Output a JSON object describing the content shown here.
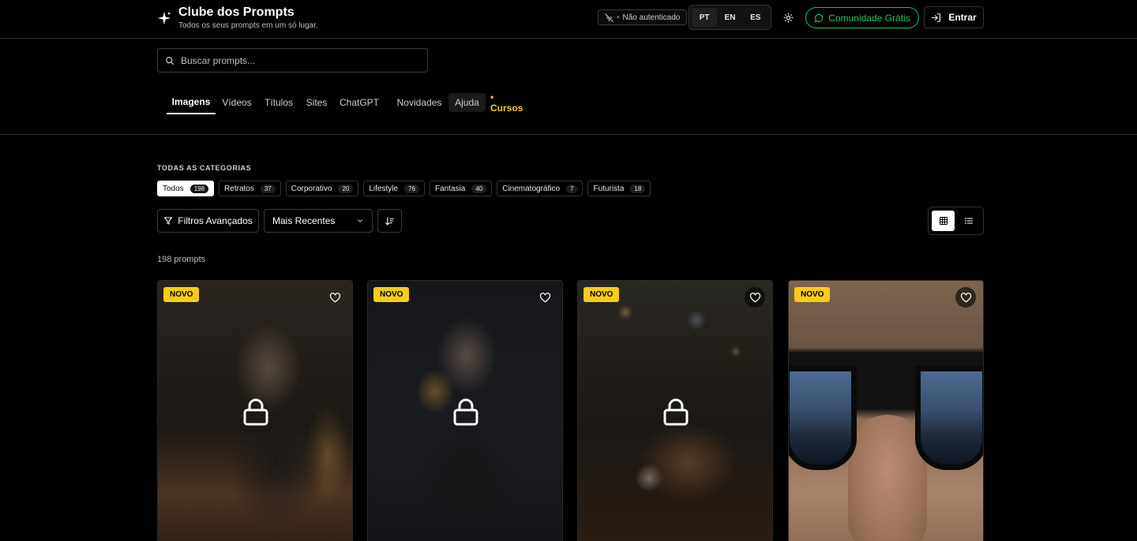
{
  "header": {
    "title": "Clube dos Prompts",
    "subtitle": "Todos os seus prompts em um só lugar.",
    "auth_status": "Não autenticado",
    "languages": [
      {
        "code": "PT",
        "active": true
      },
      {
        "code": "EN",
        "active": false
      },
      {
        "code": "ES",
        "active": false
      }
    ],
    "community_label": "Comunidade Grátis",
    "login_label": "Entrar",
    "accent_green": "#22c55e"
  },
  "search": {
    "placeholder": "Buscar prompts...",
    "value": ""
  },
  "nav": {
    "tabs": [
      {
        "label": "Imagens",
        "active": true
      },
      {
        "label": "Vídeos",
        "active": false
      },
      {
        "label": "Títulos",
        "active": false
      },
      {
        "label": "Sites",
        "active": false
      },
      {
        "label": "ChatGPT",
        "active": false
      },
      {
        "label": "Novidades",
        "active": false
      },
      {
        "label": "Ajuda",
        "active": false
      },
      {
        "label": "• Cursos",
        "active": false
      }
    ]
  },
  "categories": {
    "title": "TODAS AS CATEGORIAS",
    "items": [
      {
        "label": "Todos",
        "count": "198",
        "active": true
      },
      {
        "label": "Retratos",
        "count": "37",
        "active": false
      },
      {
        "label": "Corporativo",
        "count": "20",
        "active": false
      },
      {
        "label": "Lifestyle",
        "count": "76",
        "active": false
      },
      {
        "label": "Fantasia",
        "count": "40",
        "active": false
      },
      {
        "label": "Cinematográfico",
        "count": "7",
        "active": false
      },
      {
        "label": "Futurista",
        "count": "18",
        "active": false
      }
    ]
  },
  "toolbar": {
    "filter_label": "Filtros Avançados",
    "sort_value": "Mais Recentes",
    "view_mode": "grid"
  },
  "results": {
    "count_label": "198 prompts"
  },
  "cards": [
    {
      "badge": "NOVO",
      "locked": true,
      "favorite": false
    },
    {
      "badge": "NOVO",
      "locked": true,
      "favorite": false
    },
    {
      "badge": "NOVO",
      "locked": true,
      "favorite": false
    },
    {
      "badge": "NOVO",
      "locked": false,
      "favorite": false
    }
  ],
  "colors": {
    "badge_yellow": "#facc15",
    "cursos_yellow": "#facc15"
  }
}
